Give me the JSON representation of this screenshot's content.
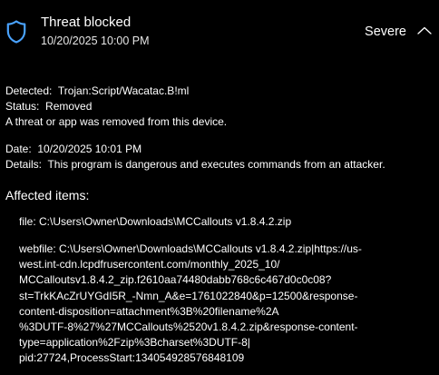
{
  "header": {
    "title": "Threat blocked",
    "timestamp": "10/20/2025 10:00 PM",
    "severity": "Severe"
  },
  "details": {
    "detected_label": "Detected:",
    "detected_value": "Trojan:Script/Wacatac.B!ml",
    "status_label": "Status:",
    "status_value": "Removed",
    "status_message": "A threat or app was removed from this device.",
    "date_label": "Date:",
    "date_value": "10/20/2025 10:01 PM",
    "details_label": "Details:",
    "details_value": "This program is dangerous and executes commands from an attacker."
  },
  "affected": {
    "title": "Affected items:",
    "file_item": "file: C:\\Users\\Owner\\Downloads\\MCCallouts v1.8.4.2.zip",
    "webfile_lines": [
      "webfile: C:\\Users\\Owner\\Downloads\\MCCallouts v1.8.4.2.zip|https://us-",
      "west.int-cdn.lcpdfrusercontent.com/monthly_2025_10/",
      "MCCalloutsv1.8.4.2_zip.f2610aa74480dabb768c6c467d0c0c08?",
      "st=TrkKAcZrUYGdI5R_-Nmn_A&e=1761022840&p=12500&response-",
      "content-disposition=attachment%3B%20filename%2A",
      "%3DUTF-8%27%27MCCallouts%2520v1.8.4.2.zip&response-content-",
      "type=application%2Fzip%3Bcharset%3DUTF-8|",
      "pid:27724,ProcessStart:134054928576848109"
    ]
  },
  "icons": {
    "shield": "shield-icon",
    "collapse": "chevron-up-icon"
  },
  "colors": {
    "background": "#000000",
    "text": "#ffffff",
    "accent": "#4aa3ff"
  }
}
